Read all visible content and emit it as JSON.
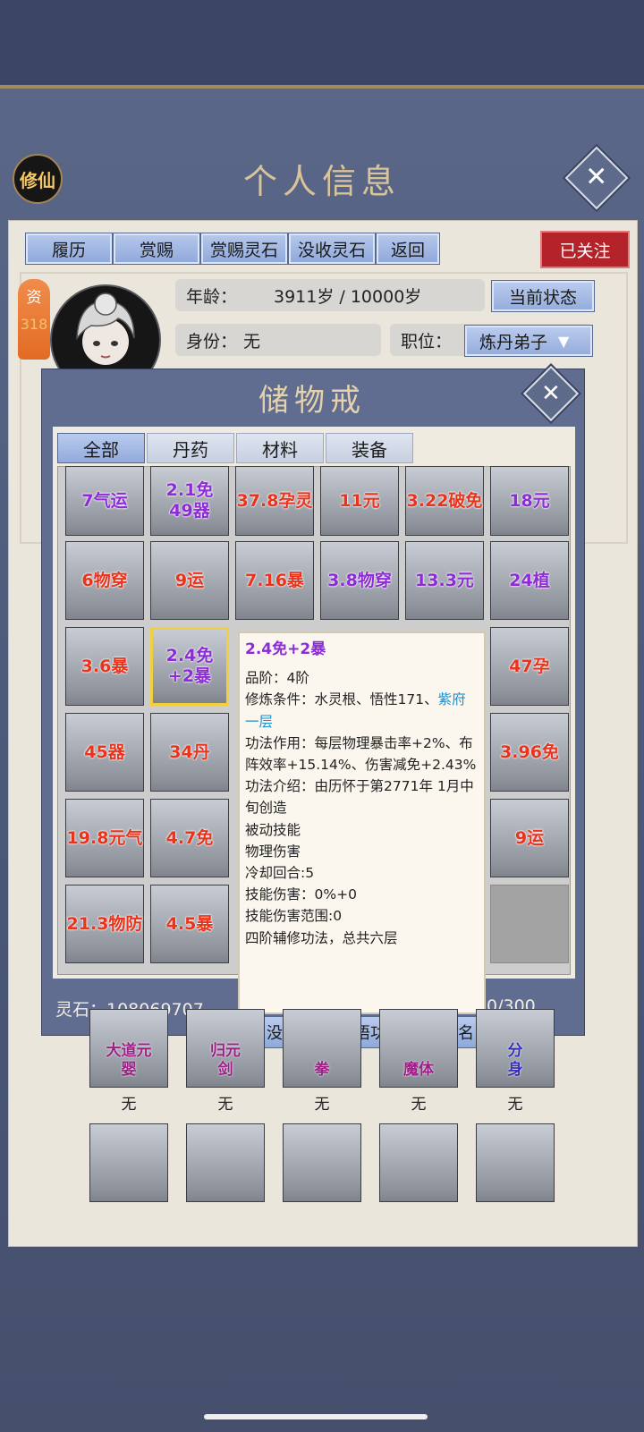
{
  "header": {
    "seal_label": "修仙",
    "title": "个人信息"
  },
  "top_tabs": [
    "履历",
    "赏赐",
    "赏赐灵石",
    "没收灵石",
    "返回"
  ],
  "follow_badge": "已关注",
  "profile": {
    "resource_label": "资",
    "resource_value": "318",
    "age_label": "年龄：",
    "age_value": "3911岁 / 10000岁",
    "status_button": "当前状态",
    "identity_label": "身份：",
    "identity_value": "无",
    "position_label": "职位：",
    "position_value": "炼丹弟子"
  },
  "storage": {
    "title": "储物戒",
    "filter_tabs": [
      "全部",
      "丹药",
      "材料",
      "装备"
    ],
    "active_tab": 0,
    "rows": [
      [
        {
          "t": "7气运",
          "c": "purple"
        },
        {
          "t": "2.1免\n49器",
          "c": "purple"
        },
        {
          "t": "37.8孕灵",
          "c": "red"
        },
        {
          "t": "11元",
          "c": "red"
        },
        {
          "t": "3.22破免",
          "c": "red"
        },
        {
          "t": "18元",
          "c": "purple"
        }
      ],
      [
        {
          "t": "6物穿",
          "c": "red"
        },
        {
          "t": "9运",
          "c": "red"
        },
        {
          "t": "7.16暴",
          "c": "red"
        },
        {
          "t": "3.8物穿",
          "c": "purple"
        },
        {
          "t": "13.3元",
          "c": "purple"
        },
        {
          "t": "24植",
          "c": "purple"
        }
      ],
      [
        {
          "t": "3.6暴",
          "c": "red"
        },
        {
          "t": "2.4免\n+2暴",
          "c": "purple",
          "selected": true
        },
        {
          "t": "",
          "c": "red"
        },
        {
          "t": "",
          "c": "red"
        },
        {
          "t": "",
          "c": "red"
        },
        {
          "t": "47孕",
          "c": "red"
        }
      ],
      [
        {
          "t": "45器",
          "c": "red"
        },
        {
          "t": "34丹",
          "c": "red"
        },
        {
          "t": "",
          "c": "red"
        },
        {
          "t": "",
          "c": "red"
        },
        {
          "t": "",
          "c": "red"
        },
        {
          "t": "3.96免",
          "c": "red"
        }
      ],
      [
        {
          "t": "19.8元气",
          "c": "red"
        },
        {
          "t": "4.7免",
          "c": "red"
        },
        {
          "t": "",
          "c": "red"
        },
        {
          "t": "",
          "c": "red"
        },
        {
          "t": "",
          "c": "red"
        },
        {
          "t": "9运",
          "c": "red"
        }
      ],
      [
        {
          "t": "21.3物防",
          "c": "red"
        },
        {
          "t": "4.5暴",
          "c": "red"
        },
        {
          "t": "",
          "c": "red"
        },
        {
          "t": "",
          "c": "red"
        },
        {
          "t": "",
          "c": "red"
        },
        {
          "t": "",
          "c": "empty"
        }
      ]
    ],
    "spirit_stone_label": "灵石：108069707",
    "capacity_text": "0/300",
    "actions": [
      "没收",
      "领悟功法",
      "改名"
    ]
  },
  "tooltip": {
    "title": "2.4免+2暴",
    "grade": "品阶：4阶",
    "requirement_prefix": "修炼条件：水灵根、悟性171、",
    "requirement_highlight": "紫府一层",
    "effect": "功法作用：每层物理暴击率+2%、布阵效率+15.14%、伤害减免+2.43%",
    "intro": "功法介绍：由历怀于第2771年 1月中旬创造",
    "lines": [
      "被动技能",
      "物理伤害",
      "冷却回合:5",
      "技能伤害：0%+0",
      "技能伤害范围:0",
      "四阶辅修功法，总共六层"
    ]
  },
  "equipment": {
    "slots": [
      {
        "name": "大道元\n婴",
        "color": "#9c1f86",
        "value": "无"
      },
      {
        "name": "归元\n剑",
        "color": "#9c1f86",
        "value": "无"
      },
      {
        "name": "拳",
        "color": "#9c1f86",
        "value": "无"
      },
      {
        "name": "魔体",
        "color": "#9c1f86",
        "value": "无"
      },
      {
        "name": "分\n身",
        "color": "#3a2fb8",
        "value": "无"
      }
    ]
  },
  "nav": {
    "left_arrow": "〈",
    "right_arrow": "〉"
  }
}
